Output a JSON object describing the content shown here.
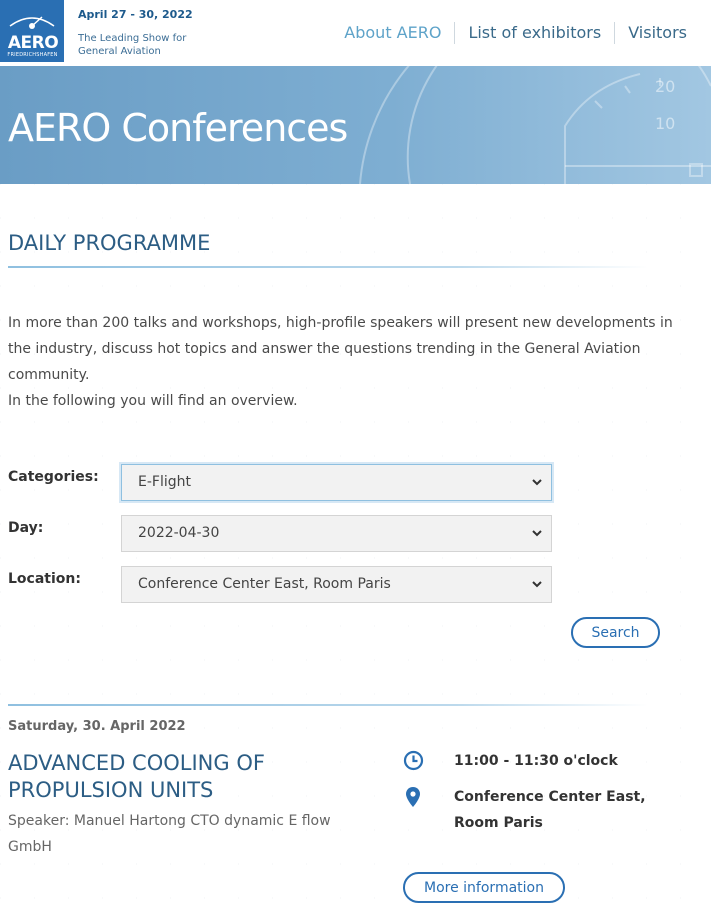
{
  "header": {
    "logo_text": "AERO",
    "logo_subtext": "FRIEDRICHSHAFEN",
    "dates": "April 27 - 30, 2022",
    "tagline": "The Leading Show for General Aviation",
    "nav": [
      {
        "label": "About AERO"
      },
      {
        "label": "List of exhibitors"
      },
      {
        "label": "Visitors"
      }
    ]
  },
  "banner": {
    "title": "AERO Conferences",
    "dial_labels": [
      "20",
      "10"
    ]
  },
  "programme": {
    "heading": "DAILY PROGRAMME",
    "intro_1": "In more than 200 talks and workshops, high-profile speakers will present new developments in the industry, discuss hot topics and answer the questions trending in the General Aviation community.",
    "intro_2": "In the following you will find an overview."
  },
  "filters": {
    "categories_label": "Categories:",
    "categories_value": "E-Flight",
    "day_label": "Day:",
    "day_value": "2022-04-30",
    "location_label": "Location:",
    "location_value": "Conference Center East, Room Paris",
    "search_label": "Search"
  },
  "event": {
    "date": "Saturday, 30. April 2022",
    "title": "ADVANCED COOLING OF PROPULSION UNITS",
    "speaker": "Speaker: Manuel Hartong CTO dynamic E flow GmbH",
    "time": "11:00 - 11:30 o'clock",
    "location": "Conference Center East, Room Paris",
    "more_label": "More information"
  },
  "colors": {
    "brand_blue": "#2a6fb3",
    "heading_blue": "#2c5d84",
    "banner_blue": "#7eaed2"
  }
}
